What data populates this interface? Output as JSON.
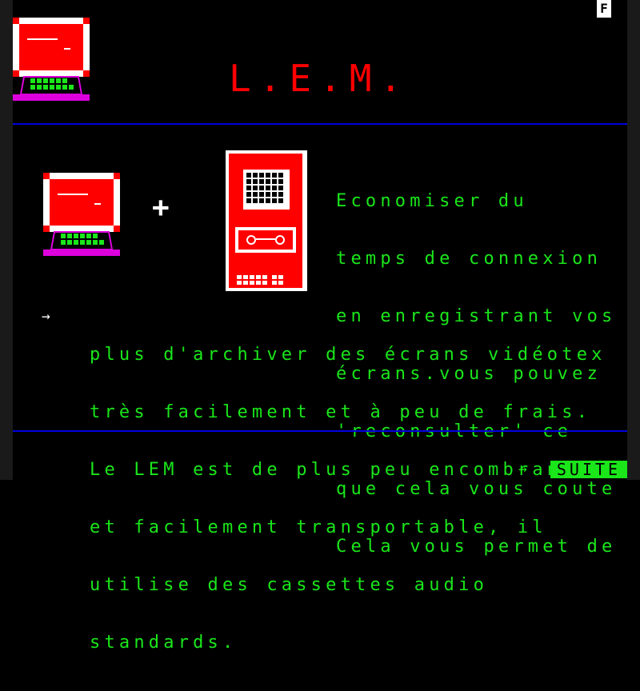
{
  "mode_indicator": "F",
  "title": "L.E.M.",
  "intro_lines": [
    "Economiser du",
    "temps de connexion",
    "en enregistrant vos",
    "écrans.vous pouvez",
    "'reconsulter' ce",
    "que cela vous coute",
    "Cela vous permet de"
  ],
  "bullet_arrow": "→",
  "body_lines": [
    "plus d'archiver des écrans vidéotex",
    "très facilement et à peu de frais.",
    "Le LEM est de plus peu encombrant",
    "et facilement transportable, il",
    "utilise des cassettes audio",
    "standards."
  ],
  "plus_sign": "+",
  "footer": {
    "arrow": "→",
    "suite_label": "SUITE"
  },
  "colors": {
    "title": "#ff0000",
    "text": "#1ae61a",
    "rule": "#0000e0",
    "background": "#000000"
  },
  "icons": [
    "computer-terminal-icon",
    "cassette-recorder-icon"
  ]
}
